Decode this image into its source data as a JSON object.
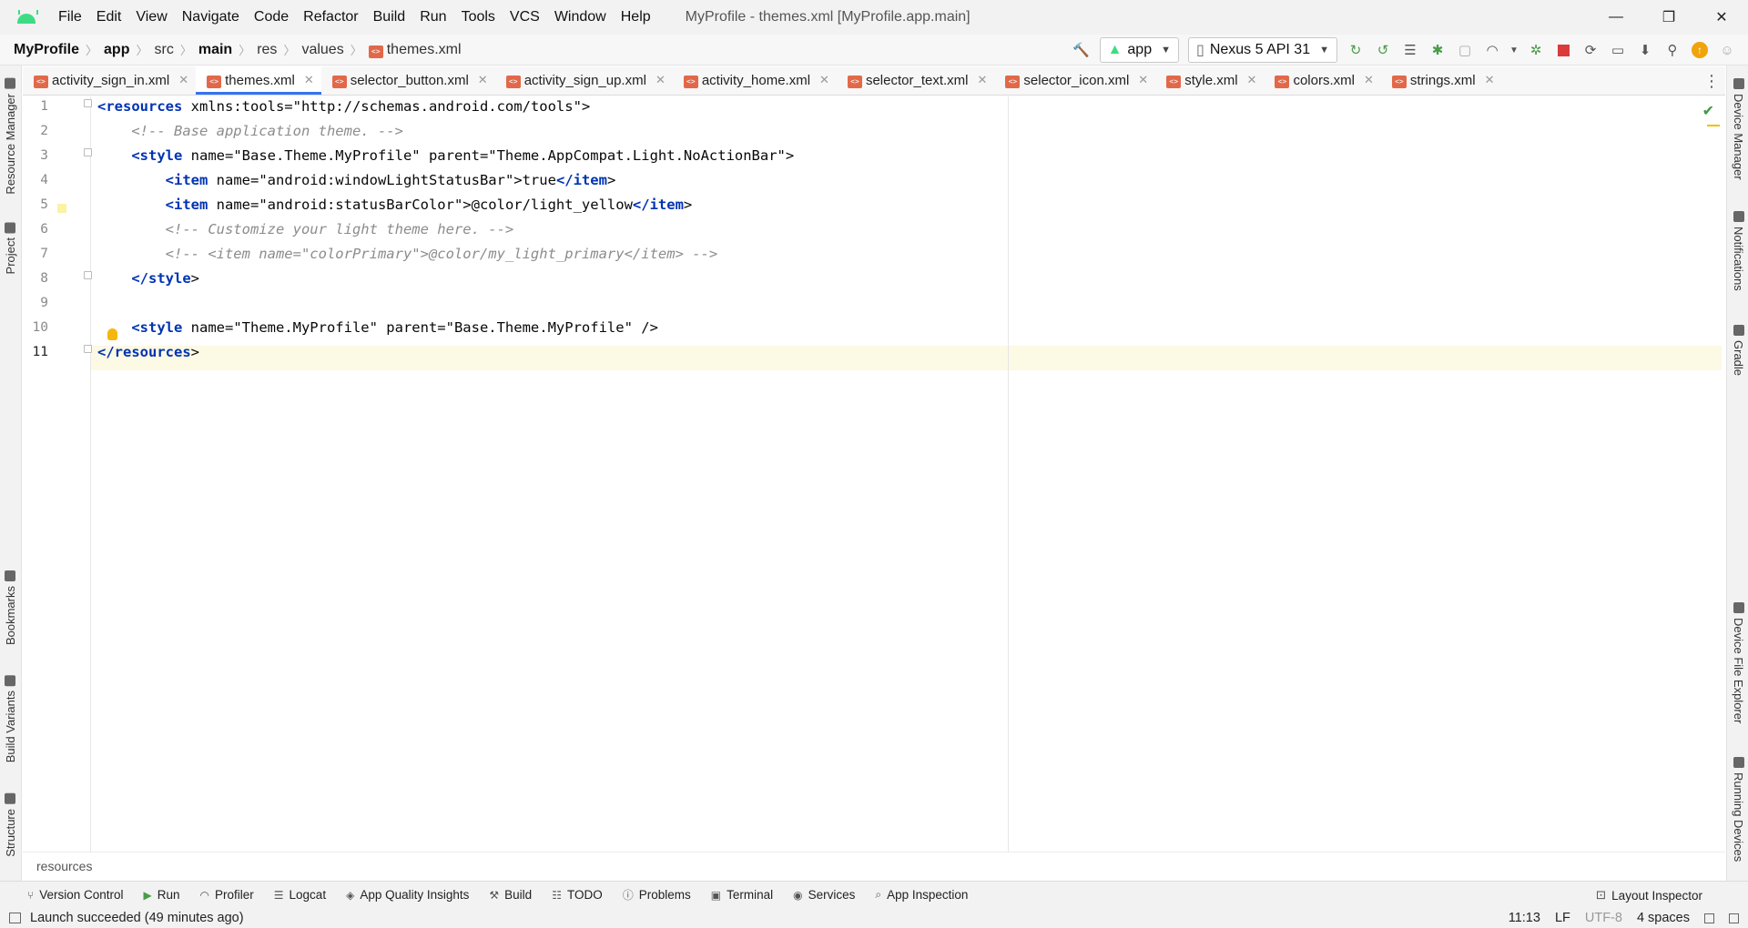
{
  "window": {
    "title": "MyProfile - themes.xml [MyProfile.app.main]",
    "menu": [
      "File",
      "Edit",
      "View",
      "Navigate",
      "Code",
      "Refactor",
      "Build",
      "Run",
      "Tools",
      "VCS",
      "Window",
      "Help"
    ],
    "controls": {
      "minimize": "—",
      "maximize": "❐",
      "close": "✕"
    }
  },
  "breadcrumb": [
    "MyProfile",
    "app",
    "src",
    "main",
    "res",
    "values",
    "themes.xml"
  ],
  "toolbar": {
    "run_config": "app",
    "device": "Nexus 5 API 31",
    "icons": [
      "hammer-icon",
      "apply-changes-icon",
      "apply-code-changes-icon",
      "profile-icon",
      "debug-icon",
      "attach-debugger-icon",
      "stop-icon",
      "sync-icon",
      "device-manager-icon",
      "sdk-manager-icon",
      "search-icon",
      "update-icon",
      "assistant-icon"
    ]
  },
  "tabs": [
    {
      "label": "activity_sign_in.xml",
      "active": false
    },
    {
      "label": "themes.xml",
      "active": true
    },
    {
      "label": "selector_button.xml",
      "active": false
    },
    {
      "label": "activity_sign_up.xml",
      "active": false
    },
    {
      "label": "activity_home.xml",
      "active": false
    },
    {
      "label": "selector_text.xml",
      "active": false
    },
    {
      "label": "selector_icon.xml",
      "active": false
    },
    {
      "label": "style.xml",
      "active": false
    },
    {
      "label": "colors.xml",
      "active": false
    },
    {
      "label": "strings.xml",
      "active": false
    }
  ],
  "left_tools": [
    "Resource Manager",
    "Project",
    "Bookmarks",
    "Build Variants",
    "Structure"
  ],
  "right_tools": [
    "Device Manager",
    "Notifications",
    "Gradle",
    "Device File Explorer",
    "Running Devices"
  ],
  "editor": {
    "line_numbers": [
      "1",
      "2",
      "3",
      "4",
      "5",
      "6",
      "7",
      "8",
      "9",
      "10",
      "11"
    ],
    "lines": [
      "<resources xmlns:tools=\"http://schemas.android.com/tools\">",
      "    <!-- Base application theme. -->",
      "    <style name=\"Base.Theme.MyProfile\" parent=\"Theme.AppCompat.Light.NoActionBar\">",
      "        <item name=\"android:windowLightStatusBar\">true</item>",
      "        <item name=\"android:statusBarColor\">@color/light_yellow</item>",
      "        <!-- Customize your light theme here. -->",
      "        <!-- <item name=\"colorPrimary\">@color/my_light_primary</item> -->",
      "    </style>",
      "",
      "    <style name=\"Theme.MyProfile\" parent=\"Base.Theme.MyProfile\" />",
      "</resources>"
    ],
    "current_line": 11
  },
  "editor_breadcrumb": "resources",
  "tool_windows": [
    {
      "label": "Version Control",
      "icon": "branch-icon"
    },
    {
      "label": "Run",
      "icon": "run-icon"
    },
    {
      "label": "Profiler",
      "icon": "profiler-icon"
    },
    {
      "label": "Logcat",
      "icon": "logcat-icon"
    },
    {
      "label": "App Quality Insights",
      "icon": "insights-icon"
    },
    {
      "label": "Build",
      "icon": "build-icon"
    },
    {
      "label": "TODO",
      "icon": "todo-icon"
    },
    {
      "label": "Problems",
      "icon": "problems-icon"
    },
    {
      "label": "Terminal",
      "icon": "terminal-icon"
    },
    {
      "label": "Services",
      "icon": "services-icon"
    },
    {
      "label": "App Inspection",
      "icon": "inspection-icon"
    }
  ],
  "layout_inspector": "Layout Inspector",
  "status": {
    "message": "Launch succeeded (49 minutes ago)",
    "position": "11:13",
    "line_sep": "LF",
    "encoding": "UTF-8",
    "indent": "4 spaces"
  }
}
